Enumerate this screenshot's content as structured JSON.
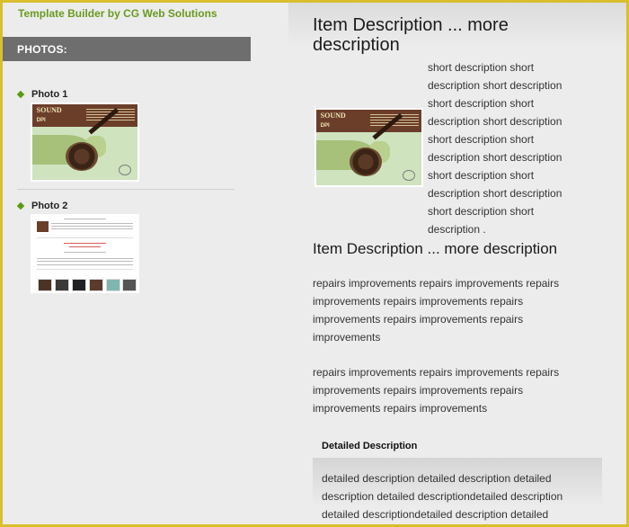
{
  "brand": "Template Builder by CG Web Solutions",
  "photos_header": "PHOTOS:",
  "photos": [
    {
      "title": "Photo 1",
      "thumb_text": [
        "SOUND",
        "DPI"
      ]
    },
    {
      "title": "Photo 2"
    }
  ],
  "item": {
    "title": "Item Description ... more description",
    "short_description": "short description short description short description short description short description short description short description short description short description short description short description short description short description short description .",
    "subtitle": "Item Description ... more description",
    "paragraph_1": "repairs improvements repairs improvements repairs improvements repairs improvements repairs improvements repairs improvements repairs improvements",
    "paragraph_2": "repairs improvements repairs improvements repairs improvements repairs improvements repairs improvements repairs improvements",
    "detailed_heading": "Detailed Description",
    "detailed_text": "detailed description detailed description detailed description detailed descriptiondetailed description detailed descriptiondetailed description detailed"
  },
  "colors": {
    "frame_border": "#d9bf2e",
    "brand_green": "#6a9a1e",
    "header_bar": "#6e6e6e",
    "bullet": "#5a9a12"
  },
  "icons": {
    "bullet": "diamond-bullet-icon"
  }
}
